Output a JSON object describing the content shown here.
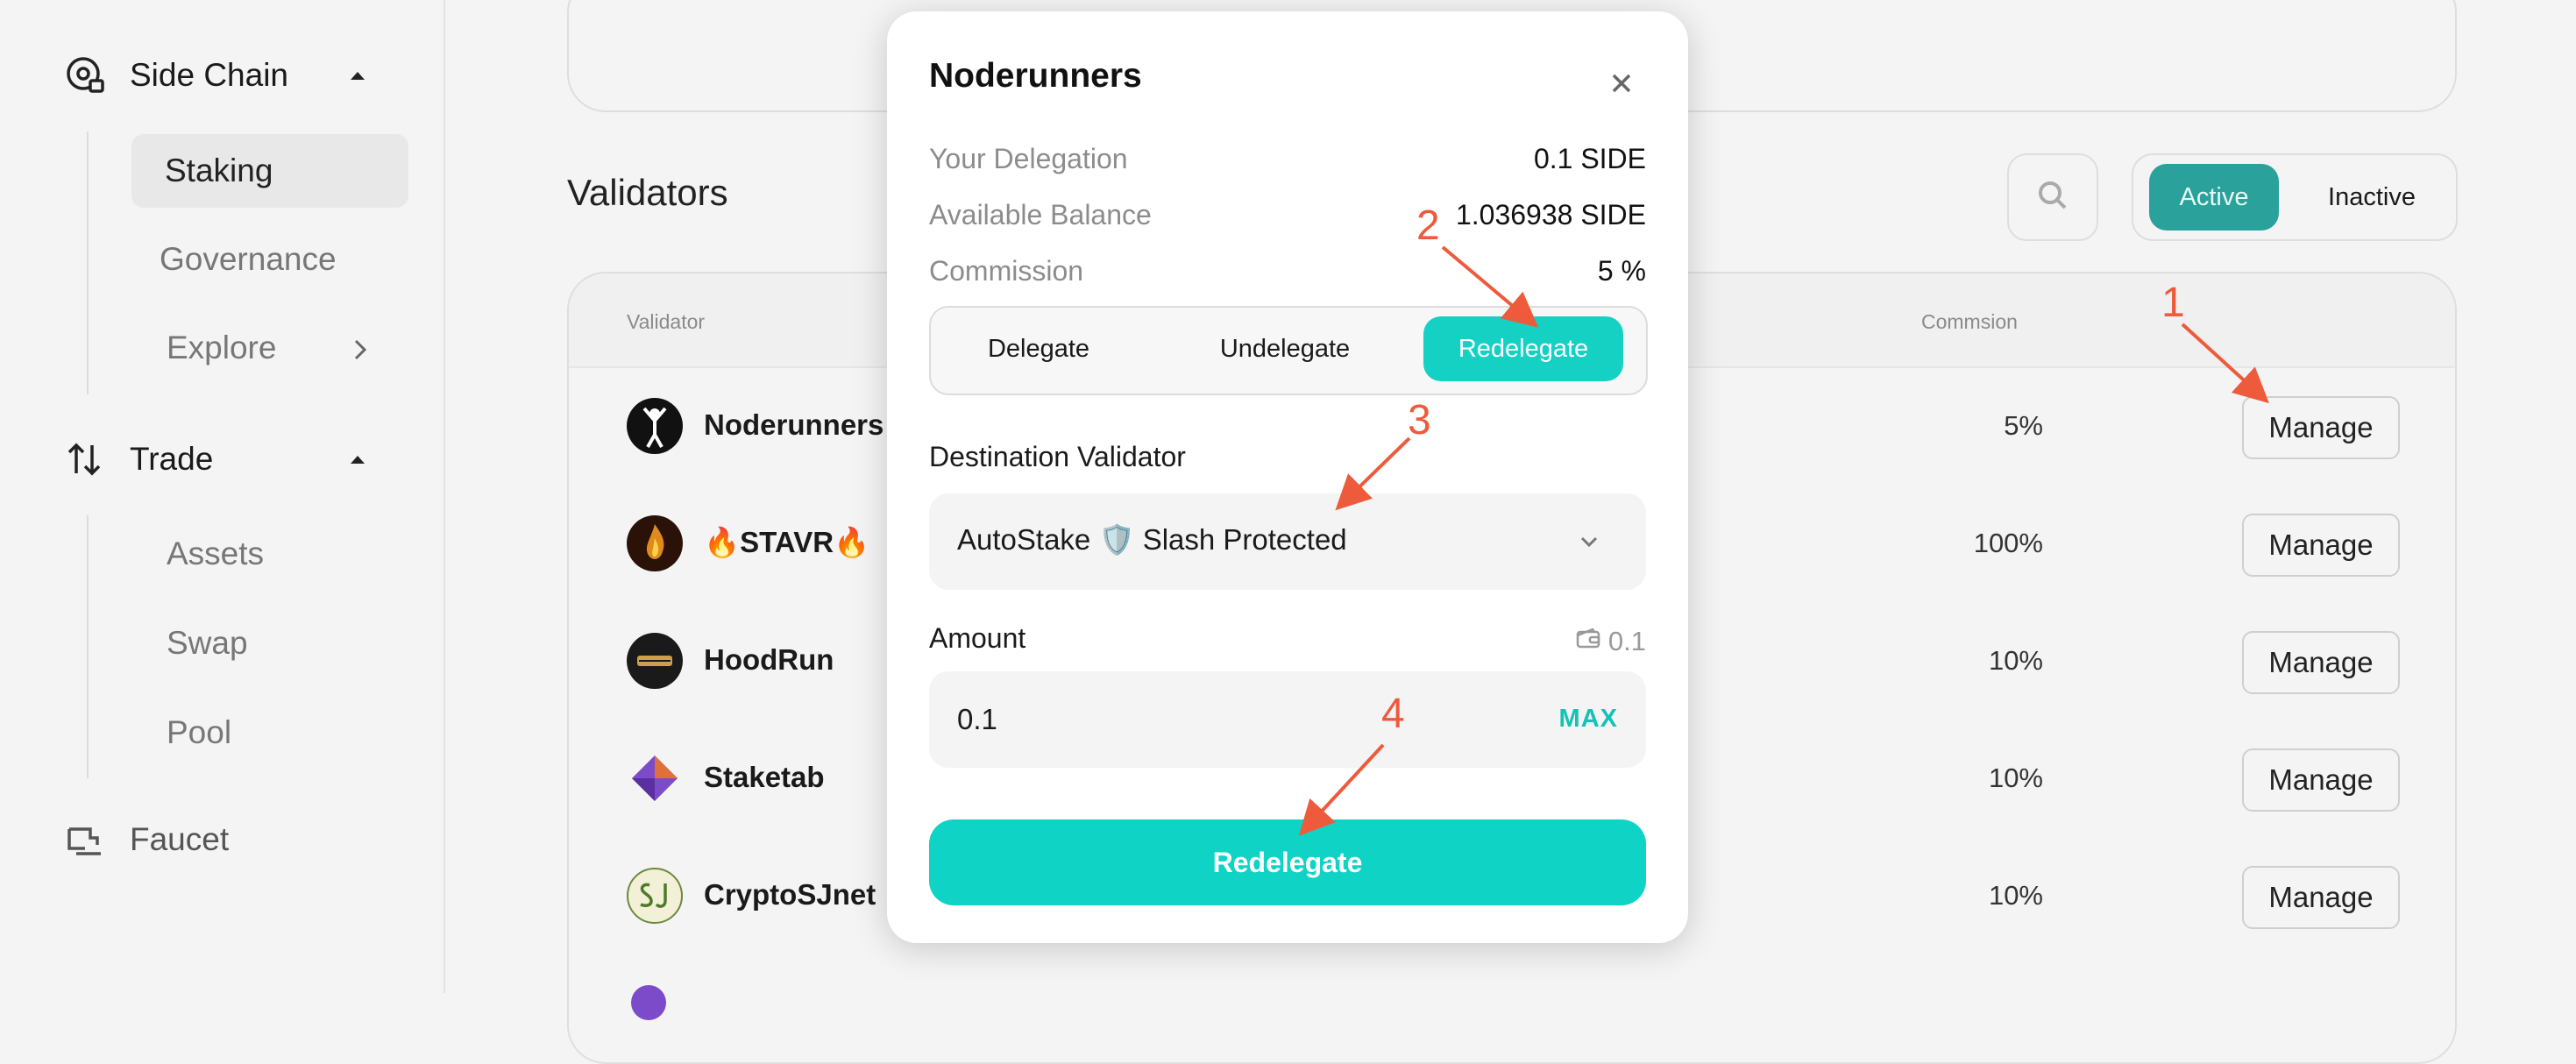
{
  "sidebar": {
    "side_chain": {
      "label": "Side Chain",
      "icon": "side-chain-icon"
    },
    "side_chain_items": [
      {
        "label": "Staking",
        "active": true
      },
      {
        "label": "Governance"
      },
      {
        "label": "Explore"
      }
    ],
    "trade": {
      "label": "Trade",
      "icon": "trade-arrows-icon"
    },
    "trade_items": [
      {
        "label": "Assets"
      },
      {
        "label": "Swap"
      },
      {
        "label": "Pool"
      }
    ],
    "faucet": {
      "label": "Faucet",
      "icon": "faucet-icon"
    }
  },
  "main": {
    "validators_title": "Validators",
    "filter": {
      "active": "Active",
      "inactive": "Inactive"
    },
    "table": {
      "col_validator": "Validator",
      "col_commission": "Commsion",
      "rows": [
        {
          "name": "Noderunners",
          "commission": "5%",
          "action": "Manage"
        },
        {
          "name": "🔥STAVR🔥",
          "commission": "100%",
          "action": "Manage"
        },
        {
          "name": "HoodRun",
          "commission": "10%",
          "action": "Manage"
        },
        {
          "name": "Staketab",
          "commission": "10%",
          "action": "Manage"
        },
        {
          "name": "CryptoSJnet",
          "commission": "10%",
          "action": "Manage"
        }
      ]
    }
  },
  "modal": {
    "title": "Noderunners",
    "your_delegation_label": "Your Delegation",
    "your_delegation_value": "0.1 SIDE",
    "available_balance_label": "Available Balance",
    "available_balance_value": "1.036938 SIDE",
    "commission_label": "Commission",
    "commission_value": "5 %",
    "tabs": {
      "delegate": "Delegate",
      "undelegate": "Undelegate",
      "redelegate": "Redelegate"
    },
    "active_tab": "Redelegate",
    "destination_label": "Destination Validator",
    "destination_value": "AutoStake 🛡️ Slash Protected",
    "amount_label": "Amount",
    "amount_balance": "0.1",
    "amount_value": "0.1",
    "max_label": "MAX",
    "submit_label": "Redelegate"
  },
  "annotations": {
    "step1": "1",
    "step2": "2",
    "step3": "3",
    "step4": "4"
  },
  "colors": {
    "accent": "#0fd3c5",
    "active_filter": "#2aa19a",
    "annotation": "#ee5a3c",
    "background": "#f4f4f4"
  }
}
